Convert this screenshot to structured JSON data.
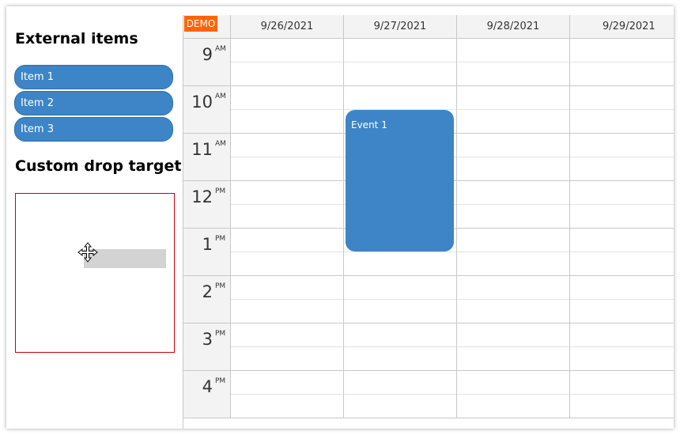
{
  "external_items": {
    "title": "External items",
    "items": [
      {
        "label": "Item 1"
      },
      {
        "label": "Item 2"
      },
      {
        "label": "Item 3"
      }
    ]
  },
  "drop_target": {
    "title": "Custom drop target"
  },
  "calendar": {
    "demo_badge": "DEMO",
    "columns": [
      "9/26/2021",
      "9/27/2021",
      "9/28/2021",
      "9/29/2021"
    ],
    "hours": [
      {
        "hour": "9",
        "ampm": "AM"
      },
      {
        "hour": "10",
        "ampm": "AM"
      },
      {
        "hour": "11",
        "ampm": "AM"
      },
      {
        "hour": "12",
        "ampm": "PM"
      },
      {
        "hour": "1",
        "ampm": "PM"
      },
      {
        "hour": "2",
        "ampm": "PM"
      },
      {
        "hour": "3",
        "ampm": "PM"
      },
      {
        "hour": "4",
        "ampm": "PM"
      }
    ],
    "event": {
      "text": "Event 1"
    }
  },
  "colors": {
    "item_blue": "#3d85c6",
    "demo_orange": "#ff6600",
    "drop_border": "#cc0000"
  }
}
